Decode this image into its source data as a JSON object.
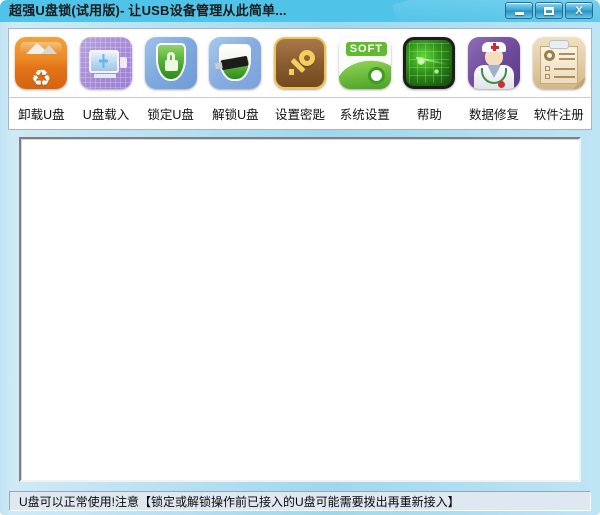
{
  "window": {
    "title": "超强U盘锁(试用版)- 让USB设备管理从此简单...",
    "accent_color": "#4fc3e8",
    "frame_color": "#9ed8ee",
    "controls": {
      "minimize_label": "",
      "maximize_label": "",
      "close_label": "X"
    }
  },
  "toolbar": {
    "items": [
      {
        "label": "卸载U盘",
        "icon": "recycle-bin-icon"
      },
      {
        "label": "U盘载入",
        "icon": "monitor-load-icon"
      },
      {
        "label": "锁定U盘",
        "icon": "shield-lock-icon"
      },
      {
        "label": "解锁U盘",
        "icon": "shield-usb-icon"
      },
      {
        "label": "设置密匙",
        "icon": "key-icon"
      },
      {
        "label": "系统设置",
        "icon": "soft-gear-icon"
      },
      {
        "label": "帮助",
        "icon": "radar-icon"
      },
      {
        "label": "数据修复",
        "icon": "doctor-icon"
      },
      {
        "label": "软件注册",
        "icon": "clipboard-gear-icon"
      }
    ]
  },
  "content": {
    "body_text": ""
  },
  "status_bar": {
    "text": "U盘可以正常使用!注意【锁定或解锁操作前已接入的U盘可能需要拨出再重新接入】"
  }
}
